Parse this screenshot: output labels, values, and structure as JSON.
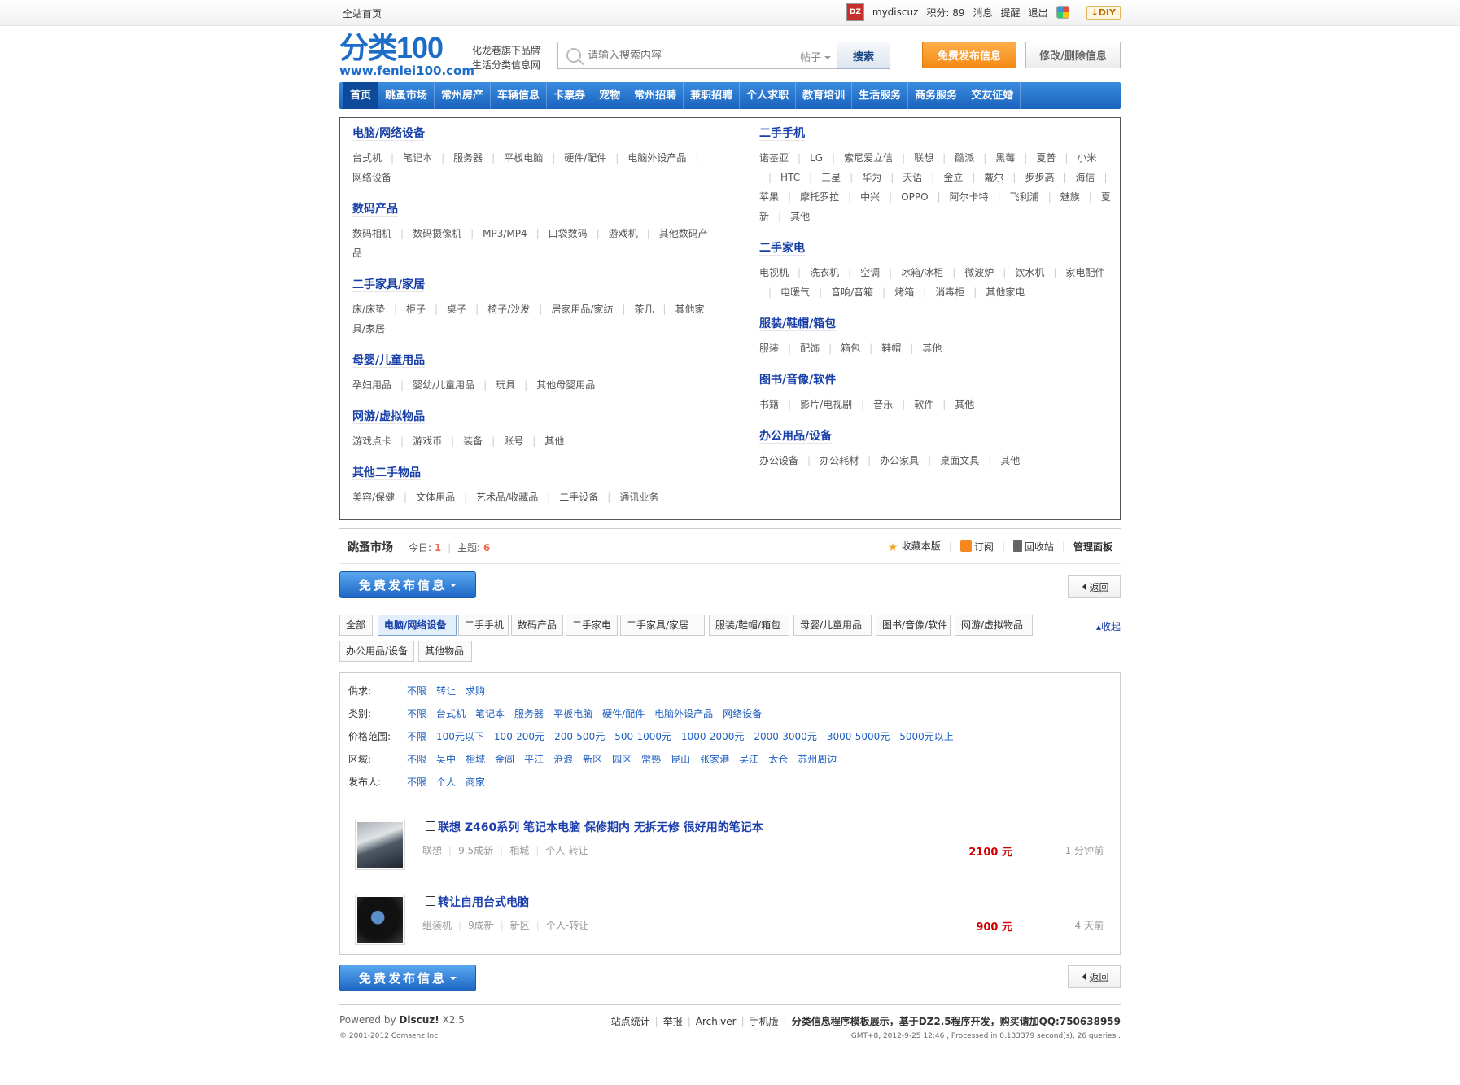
{
  "topbar": {
    "home": "全站首页",
    "avatar_text": "DZ",
    "username": "mydiscuz",
    "points": "积分: 89",
    "messages": "消息",
    "reminders": "提醒",
    "logout": "退出",
    "diy": "DIY"
  },
  "header": {
    "logo_main": "分类100",
    "logo_url": "www.fenlei100.com",
    "slogan_1": "化龙巷旗下品牌",
    "slogan_2": "生活分类信息网",
    "search_placeholder": "请输入搜索内容",
    "search_scope": "帖子",
    "search_button": "搜索",
    "post_button": "免费发布信息",
    "edit_button": "修改/删除信息"
  },
  "nav": [
    "首页",
    "跳蚤市场",
    "常州房产",
    "车辆信息",
    "卡票券",
    "宠物",
    "常州招聘",
    "兼职招聘",
    "个人求职",
    "教育培训",
    "生活服务",
    "商务服务",
    "交友征婚"
  ],
  "categories": {
    "left": [
      {
        "title": "电脑/网络设备",
        "items": [
          "台式机",
          "笔记本",
          "服务器",
          "平板电脑",
          "硬件/配件",
          "电脑外设产品",
          "网络设备"
        ]
      },
      {
        "title": "数码产品",
        "items": [
          "数码相机",
          "数码摄像机",
          "MP3/MP4",
          "口袋数码",
          "游戏机",
          "其他数码产品"
        ]
      },
      {
        "title": "二手家具/家居",
        "items": [
          "床/床垫",
          "柜子",
          "桌子",
          "椅子/沙发",
          "居家用品/家纺",
          "茶几",
          "其他家具/家居"
        ]
      },
      {
        "title": "母婴/儿童用品",
        "items": [
          "孕妇用品",
          "婴幼/儿童用品",
          "玩具",
          "其他母婴用品"
        ]
      },
      {
        "title": "网游/虚拟物品",
        "items": [
          "游戏点卡",
          "游戏币",
          "装备",
          "账号",
          "其他"
        ]
      },
      {
        "title": "其他二手物品",
        "items": [
          "美容/保健",
          "文体用品",
          "艺术品/收藏品",
          "二手设备",
          "通讯业务"
        ]
      }
    ],
    "right": [
      {
        "title": "二手手机",
        "items": [
          "诺基亚",
          "LG",
          "索尼爱立信",
          "联想",
          "酷派",
          "黑莓",
          "夏普",
          "小米",
          "HTC",
          "三星",
          "华为",
          "天语",
          "金立",
          "戴尔",
          "步步高",
          "海信",
          "苹果",
          "摩托罗拉",
          "中兴",
          "OPPO",
          "阿尔卡特",
          "飞利浦",
          "魅族",
          "夏新",
          "其他"
        ]
      },
      {
        "title": "二手家电",
        "items": [
          "电视机",
          "洗衣机",
          "空调",
          "冰箱/冰柜",
          "微波炉",
          "饮水机",
          "家电配件",
          "电暖气",
          "音响/音箱",
          "烤箱",
          "消毒柜",
          "其他家电"
        ]
      },
      {
        "title": "服装/鞋帽/箱包",
        "items": [
          "服装",
          "配饰",
          "箱包",
          "鞋帽",
          "其他"
        ]
      },
      {
        "title": "图书/音像/软件",
        "items": [
          "书籍",
          "影片/电视剧",
          "音乐",
          "软件",
          "其他"
        ]
      },
      {
        "title": "办公用品/设备",
        "items": [
          "办公设备",
          "办公耗材",
          "办公家具",
          "桌面文具",
          "其他"
        ]
      }
    ]
  },
  "forum": {
    "name": "跳蚤市场",
    "today_label": "今日:",
    "today_value": "1",
    "topics_label": "主题:",
    "topics_value": "6",
    "fav": "收藏本版",
    "subscribe": "订阅",
    "recycle": "回收站",
    "admin": "管理面板"
  },
  "actions": {
    "post": "免费发布信息",
    "back": "返回"
  },
  "tabs": [
    "全部",
    "电脑/网络设备",
    "二手手机",
    "数码产品",
    "二手家电",
    "二手家具/家居",
    "服装/鞋帽/箱包",
    "母婴/儿童用品",
    "图书/音像/软件",
    "网游/虚拟物品",
    "办公用品/设备",
    "其他物品"
  ],
  "collapse": "收起",
  "filters": [
    {
      "label": "供求:",
      "options": [
        "不限",
        "转让",
        "求购"
      ]
    },
    {
      "label": "类别:",
      "options": [
        "不限",
        "台式机",
        "笔记本",
        "服务器",
        "平板电脑",
        "硬件/配件",
        "电脑外设产品",
        "网络设备"
      ]
    },
    {
      "label": "价格范围:",
      "options": [
        "不限",
        "100元以下",
        "100-200元",
        "200-500元",
        "500-1000元",
        "1000-2000元",
        "2000-3000元",
        "3000-5000元",
        "5000元以上"
      ]
    },
    {
      "label": "区域:",
      "options": [
        "不限",
        "吴中",
        "相城",
        "金阊",
        "平江",
        "沧浪",
        "新区",
        "园区",
        "常熟",
        "昆山",
        "张家港",
        "吴江",
        "太仓",
        "苏州周边"
      ]
    },
    {
      "label": "发布人:",
      "options": [
        "不限",
        "个人",
        "商家"
      ]
    }
  ],
  "listings": [
    {
      "title": "联想 Z460系列 笔记本电脑 保修期内 无拆无修 很好用的笔记本",
      "meta": [
        "联想",
        "9.5成新",
        "相城",
        "个人-转让"
      ],
      "price": "2100",
      "unit": "元",
      "time": "1 分钟前"
    },
    {
      "title": "转让自用台式电脑",
      "meta": [
        "组装机",
        "9成新",
        "新区",
        "个人-转让"
      ],
      "price": "900",
      "unit": "元",
      "time": "4 天前"
    }
  ],
  "footer": {
    "powered_prefix": "Powered by",
    "powered_brand": "Discuz!",
    "powered_version": "X2.5",
    "copyright": "© 2001-2012 Comsenz Inc.",
    "links": [
      "站点统计",
      "举报",
      "Archiver",
      "手机版"
    ],
    "note": "分类信息程序模板展示，基于DZ2.5程序开发，购买请加QQ:750638959",
    "info": "GMT+8, 2012-9-25 12:46 , Processed in 0.133379 second(s), 26 queries ."
  }
}
